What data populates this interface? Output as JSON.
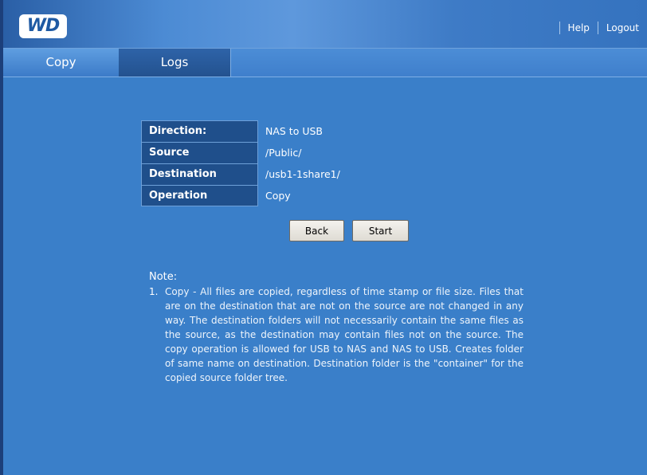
{
  "header": {
    "logo_text": "WD",
    "help_label": "Help",
    "logout_label": "Logout"
  },
  "tabs": [
    {
      "label": "Copy",
      "active": true
    },
    {
      "label": "Logs",
      "active": false
    }
  ],
  "info": {
    "rows": [
      {
        "label": "Direction:",
        "value": "NAS to USB"
      },
      {
        "label": "Source",
        "value": "/Public/"
      },
      {
        "label": "Destination",
        "value": "/usb1-1share1/"
      },
      {
        "label": "Operation",
        "value": "Copy"
      }
    ]
  },
  "buttons": {
    "back_label": "Back",
    "start_label": "Start"
  },
  "notes": {
    "title": "Note:",
    "items": [
      {
        "number": "1.",
        "text": "Copy - All files are copied, regardless of time stamp or file size. Files that are on the destination that are not on the source are not changed in any way. The destination folders will not necessarily contain the same files as the source, as the destination may contain files not on the source. The copy operation is allowed for USB to NAS and NAS to USB. Creates folder of same name on destination. Destination folder is the \"container\" for the copied source folder tree."
      }
    ]
  },
  "colors": {
    "background": "#3a7fc9",
    "label_cell": "#1f4f8b",
    "button_face": "#e8e5de"
  }
}
